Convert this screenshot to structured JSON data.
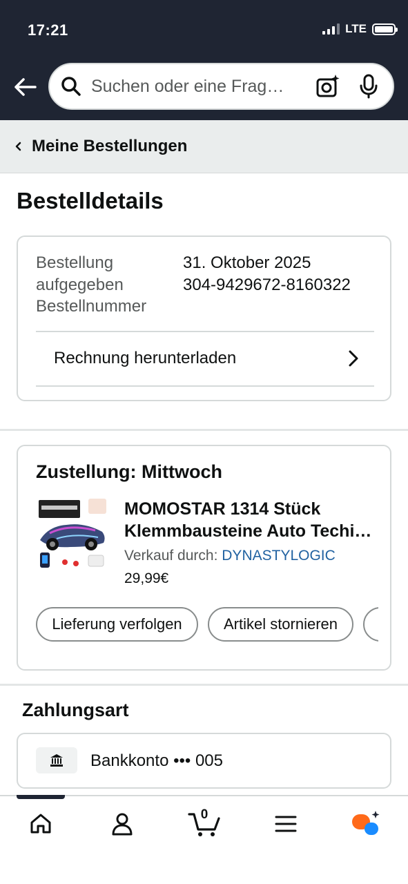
{
  "status_bar": {
    "time": "17:21",
    "network": "LTE"
  },
  "search": {
    "placeholder": "Suchen oder eine Frag…"
  },
  "breadcrumb": {
    "label": "Meine Bestellungen"
  },
  "page": {
    "title": "Bestelldetails"
  },
  "order_info": {
    "placed_label_line1": "Bestellung",
    "placed_label_line2": "aufgegeben",
    "number_label": "Bestellnummer",
    "placed_value": "31. Oktober 2025",
    "number_value": "304-9429672-8160322",
    "invoice_link": "Rechnung herunterladen"
  },
  "delivery": {
    "title": "Zustellung: Mittwoch",
    "product_title_line1": "MOMOSTAR 1314 Stück",
    "product_title_line2": "Klemmbausteine Auto Techi…",
    "seller_prefix": "Verkauf durch:",
    "seller_name": "DYNASTYLOGIC",
    "price": "29,99€",
    "actions": [
      "Lieferung verfolgen",
      "Artikel stornieren"
    ]
  },
  "payment": {
    "title": "Zahlungsart",
    "method": "Bankkonto ••• 005"
  },
  "bottom_nav": {
    "cart_count": "0",
    "items": [
      "home-icon",
      "account-icon",
      "cart-icon",
      "menu-icon",
      "rufus-icon"
    ]
  },
  "colors": {
    "header_bg": "#1f2533",
    "link": "#2162a1",
    "rufus_orange": "#ff6a1a",
    "rufus_blue": "#1a8cff"
  }
}
